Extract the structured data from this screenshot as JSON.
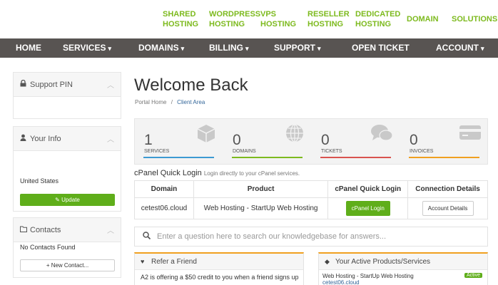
{
  "top_links": [
    "SHARED\nHOSTING",
    "WORDPRESS\nHOSTING",
    "VPS\nHOSTING",
    "RESELLER\nHOSTING",
    "DEDICATED\nHOSTING",
    "DOMAIN",
    "SOLUTIONS"
  ],
  "nav": {
    "home": "HOME",
    "services": "SERVICES",
    "domains": "DOMAINS",
    "billing": "BILLING",
    "support": "SUPPORT",
    "open_ticket": "OPEN TICKET",
    "account": "ACCOUNT"
  },
  "sidebar": {
    "support_pin": {
      "title": "Support PIN"
    },
    "your_info": {
      "title": "Your Info",
      "country": "United States",
      "update_label": "Update"
    },
    "contacts": {
      "title": "Contacts",
      "empty_text": "No Contacts Found",
      "new_contact_label": "+ New Contact..."
    }
  },
  "main": {
    "title": "Welcome Back",
    "breadcrumb": {
      "home": "Portal Home",
      "separator": "/",
      "current": "Client Area"
    },
    "stats": [
      {
        "value": "1",
        "label": "SERVICES",
        "color": "#3c9ad2",
        "icon": "cube-icon"
      },
      {
        "value": "0",
        "label": "DOMAINS",
        "color": "#7dba1e",
        "icon": "globe-icon"
      },
      {
        "value": "0",
        "label": "TICKETS",
        "color": "#d9534f",
        "icon": "chat-icon"
      },
      {
        "value": "0",
        "label": "INVOICES",
        "color": "#f0a020",
        "icon": "credit-card-icon"
      }
    ],
    "cpanel": {
      "title": "cPanel Quick Login",
      "subtitle": "Login directly to your cPanel services.",
      "headers": [
        "Domain",
        "Product",
        "cPanel Quick Login",
        "Connection Details"
      ],
      "row": {
        "domain": "cetest06.cloud",
        "product": "Web Hosting - StartUp Web Hosting",
        "login_label": "cPanel Login",
        "details_label": "Account Details"
      }
    },
    "search": {
      "placeholder": "Enter a question here to search our knowledgebase for answers..."
    },
    "refer": {
      "title": "Refer a Friend",
      "text": "A2 is offering a $50 credit to you when a friend signs up"
    },
    "products": {
      "title": "Your Active Products/Services",
      "item": "Web Hosting - StartUp Web Hosting",
      "domain": "cetest06.cloud",
      "status": "Active"
    }
  }
}
